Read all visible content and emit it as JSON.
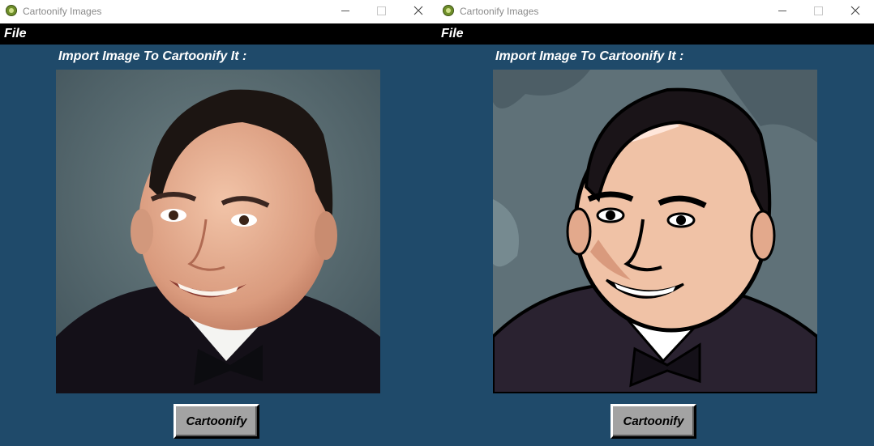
{
  "windows": [
    {
      "title": "Cartoonify Images",
      "menu_file": "File",
      "heading": "Import Image To Cartoonify It :",
      "button_label": "Cartoonify",
      "image_style": "original photo"
    },
    {
      "title": "Cartoonify Images",
      "menu_file": "File",
      "heading": "Import Image To Cartoonify It :",
      "button_label": "Cartoonify",
      "image_style": "cartoonified"
    }
  ],
  "colors": {
    "window_background": "#1f4a6a",
    "menubar_background": "#000000",
    "button_background": "#a3a3a3"
  }
}
